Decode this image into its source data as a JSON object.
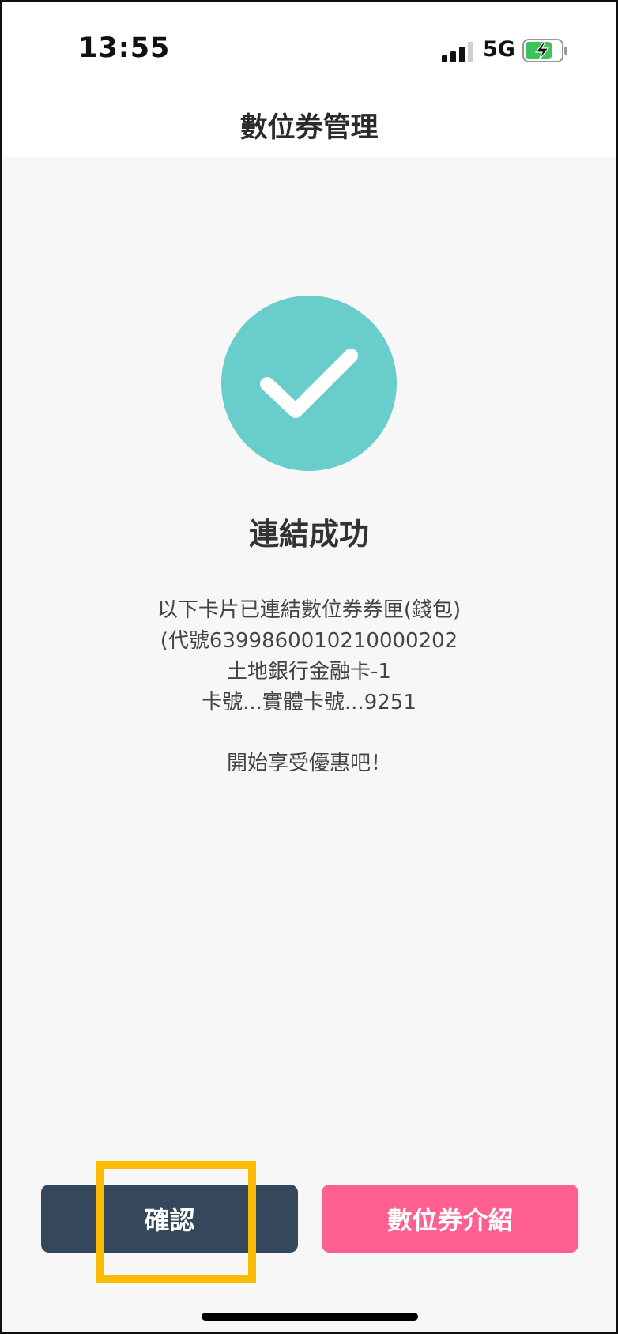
{
  "status_bar": {
    "time": "13:55",
    "network": "5G",
    "icons": [
      "signal-icon",
      "battery-charging-icon"
    ]
  },
  "nav": {
    "title": "數位券管理"
  },
  "result": {
    "icon": "check-icon",
    "title": "連結成功",
    "lines": [
      "以下卡片已連結數位券券匣(錢包)",
      "(代號6399860010210000202",
      "土地銀行金融卡-1",
      "卡號...實體卡號...9251",
      "開始享受優惠吧！"
    ]
  },
  "buttons": {
    "confirm": "確認",
    "intro": "數位券介紹"
  },
  "colors": {
    "success": "#69cdcc",
    "confirm_bg": "#34475b",
    "intro_bg": "#ff6090",
    "highlight": "#fcbb05"
  }
}
